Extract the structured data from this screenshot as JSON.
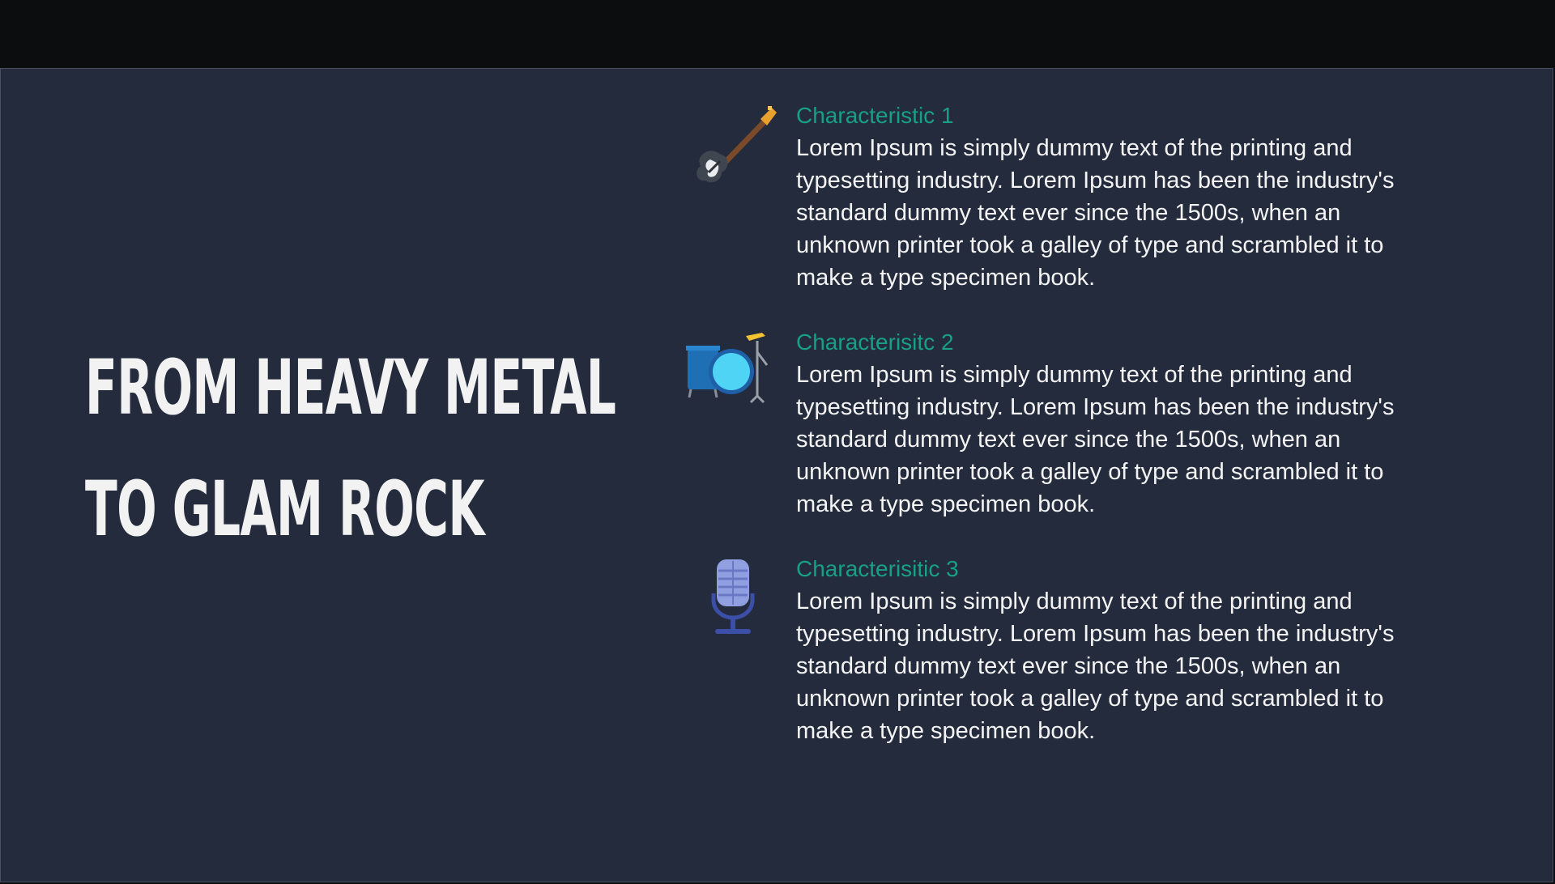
{
  "headline": {
    "line1": "FROM HEAVY METAL",
    "line2": "TO GLAM ROCK"
  },
  "characteristics": [
    {
      "icon": "electric-guitar-icon",
      "title": "Characteristic 1",
      "body": "Lorem Ipsum is simply dummy text of the printing and\n typesetting industry.  Lorem Ipsum has been the industry's\nstandard dummy text ever since the 1500s,  when an\nunknown printer took a galley of type and scrambled it to\nmake a type specimen book."
    },
    {
      "icon": "drum-kit-icon",
      "title": "Characterisitc 2",
      "body": "Lorem Ipsum is simply dummy text of the printing and\n typesetting industry.  Lorem Ipsum has been the industry's\nstandard dummy text ever since the 1500s,  when an\nunknown printer took a galley of type and scrambled it to\nmake a type specimen book."
    },
    {
      "icon": "microphone-icon",
      "title": "Characterisitic 3",
      "body": "Lorem Ipsum is simply dummy text of the printing and\n typesetting industry.  Lorem Ipsum has been the industry's\nstandard dummy text ever since the 1500s,  when an\nunknown printer took a galley of type and scrambled it to\nmake a type specimen book."
    }
  ],
  "colors": {
    "slide_background": "#232b3d",
    "title_accent": "#17a085",
    "text": "#f4f4f4"
  }
}
